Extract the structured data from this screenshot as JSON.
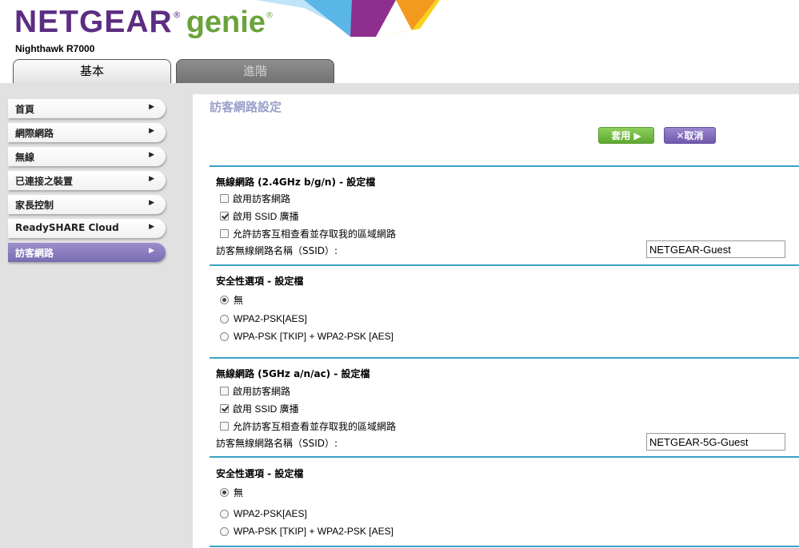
{
  "brand": {
    "name": "NETGEAR",
    "product": "genie",
    "reg_mark": "®",
    "model": "Nighthawk R7000",
    "colors": {
      "purple": "#5c2d82",
      "green": "#6aa33a"
    }
  },
  "tabs": [
    {
      "label": "基本",
      "active": true
    },
    {
      "label": "進階",
      "active": false
    }
  ],
  "sidebar": {
    "items": [
      {
        "label": "首頁",
        "arrow": "▶"
      },
      {
        "label": "網際網路",
        "arrow": "▶"
      },
      {
        "label": "無線",
        "arrow": "▶"
      },
      {
        "label": "已連接之裝置",
        "arrow": "▶"
      },
      {
        "label": "家長控制",
        "arrow": "▶"
      },
      {
        "label": "ReadySHARE Cloud",
        "arrow": "▶"
      },
      {
        "label": "訪客網路",
        "arrow": "▶",
        "active": true
      }
    ]
  },
  "main": {
    "title": "訪客網路設定",
    "apply_label": "套用 ▶",
    "cancel_label": "✕取消",
    "band24": {
      "title": "無線網路 (2.4GHz b/g/n) - 設定檔",
      "options": [
        {
          "label": "啟用訪客網路",
          "checked": false
        },
        {
          "label": "啟用 SSID 廣播",
          "checked": true
        },
        {
          "label": "允許訪客互相查看並存取我的區域網路",
          "checked": false
        }
      ],
      "ssid_label": "訪客無線網路名稱（SSID）:",
      "ssid_value": "NETGEAR-Guest"
    },
    "security24": {
      "title": "安全性選項 - 設定檔",
      "options": [
        {
          "label": "無",
          "selected": true
        },
        {
          "label": "WPA2-PSK[AES]",
          "selected": false
        },
        {
          "label": "WPA-PSK [TKIP] + WPA2-PSK [AES]",
          "selected": false
        }
      ]
    },
    "band5": {
      "title": "無線網路 (5GHz a/n/ac) - 設定檔",
      "options": [
        {
          "label": "啟用訪客網路",
          "checked": false
        },
        {
          "label": "啟用 SSID 廣播",
          "checked": true
        },
        {
          "label": "允許訪客互相查看並存取我的區域網路",
          "checked": false
        }
      ],
      "ssid_label": "訪客無線網路名稱（SSID）:",
      "ssid_value": "NETGEAR-5G-Guest"
    },
    "security5": {
      "title": "安全性選項 - 設定檔",
      "options": [
        {
          "label": "無",
          "selected": true
        },
        {
          "label": "WPA2-PSK[AES]",
          "selected": false
        },
        {
          "label": "WPA-PSK [TKIP] + WPA2-PSK [AES]",
          "selected": false
        }
      ]
    },
    "colors": {
      "rule": "#3aa2c4",
      "apply": "#6ab63c",
      "cancel": "#7a63b8",
      "title": "#9b9fc7",
      "active_nav": "#8a7cc0"
    }
  }
}
